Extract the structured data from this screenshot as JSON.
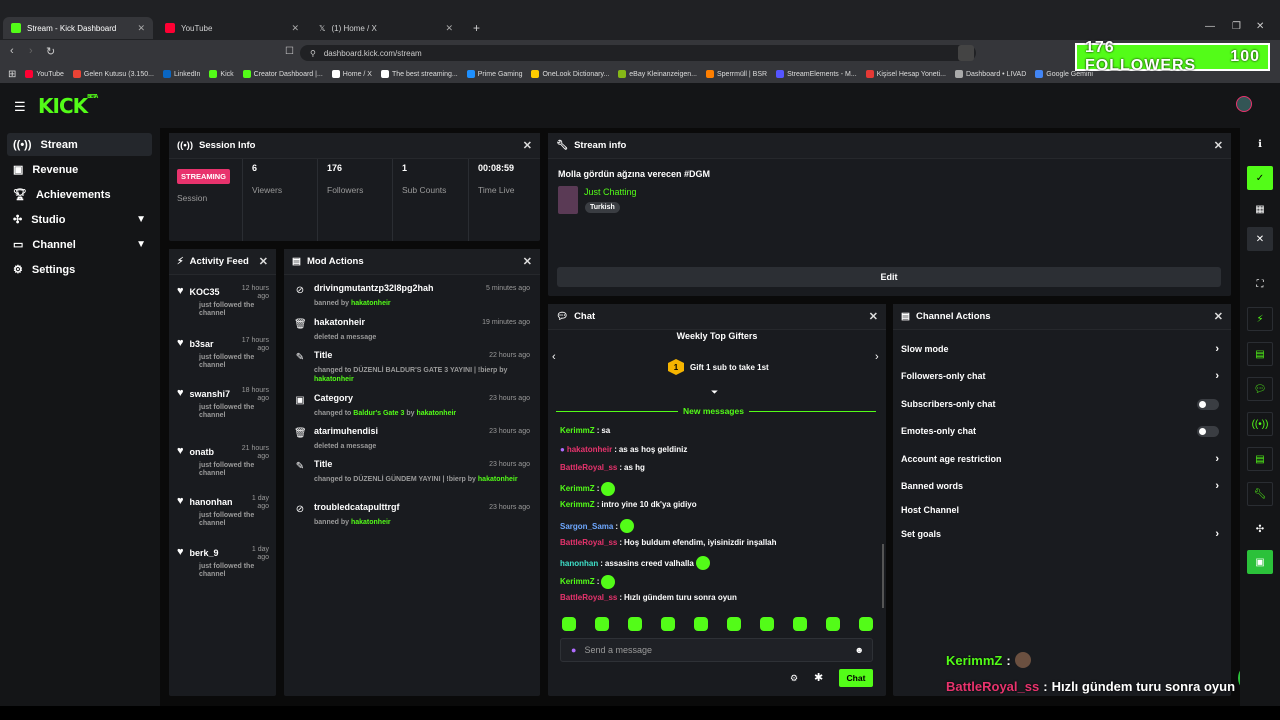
{
  "browser": {
    "tabs": [
      {
        "title": "Stream - Kick Dashboard",
        "color": "#53fc18"
      },
      {
        "title": "YouTube",
        "color": "#ff0033"
      },
      {
        "title": "(1) Home / X",
        "color": "#ffffff"
      }
    ],
    "url": "dashboard.kick.com/stream",
    "bookmarks": [
      {
        "label": "YouTube",
        "color": "#ff0033"
      },
      {
        "label": "Gelen Kutusu (3.150...",
        "color": "#ea4335"
      },
      {
        "label": "LinkedIn",
        "color": "#0a66c2"
      },
      {
        "label": "Kick",
        "color": "#53fc18"
      },
      {
        "label": "Creator Dashboard |...",
        "color": "#53fc18"
      },
      {
        "label": "Home / X",
        "color": "#ffffff"
      },
      {
        "label": "The best streaming...",
        "color": "#ffffff"
      },
      {
        "label": "Prime Gaming",
        "color": "#1e90ff"
      },
      {
        "label": "OneLook Dictionary...",
        "color": "#ffcc00"
      },
      {
        "label": "eBay Kleinanzeigen...",
        "color": "#86b817"
      },
      {
        "label": "Sperrmüll | BSR",
        "color": "#ff7f00"
      },
      {
        "label": "StreamElements - M...",
        "color": "#5555ff"
      },
      {
        "label": "Kişisel Hesap Yoneti...",
        "color": "#e53935"
      },
      {
        "label": "Dashboard • LIVAD",
        "color": "#aaaaaa"
      },
      {
        "label": "Google Gemini",
        "color": "#4285f4"
      }
    ]
  },
  "overlay": {
    "followers_label": "176 FOLLOWERS",
    "followers_goal": "100"
  },
  "app": {
    "logo": "KICK",
    "logo_badge": "BETA"
  },
  "sidebar": {
    "items": [
      {
        "label": "Stream",
        "icon": "broadcast-icon"
      },
      {
        "label": "Revenue",
        "icon": "wallet-icon"
      },
      {
        "label": "Achievements",
        "icon": "trophy-icon"
      },
      {
        "label": "Studio",
        "icon": "studio-icon"
      },
      {
        "label": "Channel",
        "icon": "channel-icon"
      },
      {
        "label": "Settings",
        "icon": "gear-icon"
      }
    ]
  },
  "session": {
    "title": "Session Info",
    "badge": "STREAMING",
    "badge_label": "Session",
    "stats": [
      {
        "value": "6",
        "label": "Viewers"
      },
      {
        "value": "176",
        "label": "Followers"
      },
      {
        "value": "1",
        "label": "Sub Counts"
      },
      {
        "value": "00:08:59",
        "label": "Time Live"
      }
    ]
  },
  "stream_info": {
    "title": "Stream info",
    "stream_title": "Molla gördün ağzına verecen #DGM",
    "category": "Just Chatting",
    "tag": "Turkish",
    "edit": "Edit"
  },
  "activity": {
    "title": "Activity Feed",
    "items": [
      {
        "name": "KOC35",
        "time": "12 hours ago",
        "desc": "just followed the channel"
      },
      {
        "name": "b3sar",
        "time": "17 hours ago",
        "desc": "just followed the channel"
      },
      {
        "name": "swanshi7",
        "time": "18 hours ago",
        "desc": "just followed the channel"
      },
      {
        "name": "onatb",
        "time": "21 hours ago",
        "desc": "just followed the channel"
      },
      {
        "name": "hanonhan",
        "time": "1 day ago",
        "desc": "just followed the channel"
      },
      {
        "name": "berk_9",
        "time": "1 day ago",
        "desc": "just followed the channel"
      }
    ]
  },
  "mod": {
    "title": "Mod Actions",
    "items": [
      {
        "title": "drivingmutantzp32l8pg2hah",
        "time": "5 minutes ago",
        "pre": "banned by",
        "by": "hakatonheir",
        "icon": "ban-icon"
      },
      {
        "title": "hakatonheir",
        "time": "19 minutes ago",
        "pre": "deleted a message",
        "by": "",
        "icon": "trash-icon"
      },
      {
        "title": "Title",
        "time": "22 hours ago",
        "pre": "changed to DÜZENLİ BALDUR'S GATE 3 YAYINI | !bierp by",
        "by": "hakatonheir",
        "icon": "edit-user-icon"
      },
      {
        "title": "Category",
        "time": "23 hours ago",
        "pre": "changed to",
        "mid": "Baldur's Gate 3",
        "post": "by",
        "by": "hakatonheir",
        "icon": "category-icon"
      },
      {
        "title": "atarimuhendisi",
        "time": "23 hours ago",
        "pre": "deleted a message",
        "by": "",
        "icon": "trash-icon"
      },
      {
        "title": "Title",
        "time": "23 hours ago",
        "pre": "changed to DÜZENLİ GÜNDEM YAYINI | !bierp by",
        "by": "hakatonheir",
        "icon": "edit-user-icon"
      },
      {
        "title": "troubledcatapulttrgf",
        "time": "23 hours ago",
        "pre": "banned by",
        "by": "hakatonheir",
        "icon": "ban-icon"
      }
    ]
  },
  "chat": {
    "title": "Chat",
    "gifters_title": "Weekly Top Gifters",
    "gifters_rank": "1",
    "gifters_text": "Gift 1 sub to take 1st",
    "new_messages": "New messages",
    "messages": [
      {
        "user": "KerimmZ",
        "color": "#53fc18",
        "text": "sa",
        "emote": false
      },
      {
        "user": "hakatonheir",
        "color": "#e8336d",
        "text": "as as hoş geldiniz",
        "emote": false
      },
      {
        "user": "BattleRoyal_ss",
        "color": "#e8336d",
        "text": "as hg",
        "emote": false
      },
      {
        "user": "KerimmZ",
        "color": "#53fc18",
        "text": "",
        "emote": true
      },
      {
        "user": "KerimmZ",
        "color": "#53fc18",
        "text": "intro yine 10 dk'ya gidiyo",
        "emote": false
      },
      {
        "user": "Sargon_Sama",
        "color": "#6ea8ff",
        "text": "",
        "emote": true
      },
      {
        "user": "BattleRoyal_ss",
        "color": "#e8336d",
        "text": "Hoş buldum efendim, iyisinizdir inşallah",
        "emote": false
      },
      {
        "user": "hanonhan",
        "color": "#3ee0c9",
        "text": "assasins creed valhalla",
        "emote": true
      },
      {
        "user": "KerimmZ",
        "color": "#53fc18",
        "text": "",
        "emote": true
      },
      {
        "user": "BattleRoyal_ss",
        "color": "#e8336d",
        "text": "Hızlı gündem turu sonra oyun",
        "emote": false
      }
    ],
    "placeholder": "Send a message",
    "send": "Chat"
  },
  "channel_actions": {
    "title": "Channel Actions",
    "items": [
      {
        "label": "Slow mode",
        "type": "arrow"
      },
      {
        "label": "Followers-only chat",
        "type": "arrow"
      },
      {
        "label": "Subscribers-only chat",
        "type": "toggle"
      },
      {
        "label": "Emotes-only chat",
        "type": "toggle"
      },
      {
        "label": "Account age restriction",
        "type": "arrow"
      },
      {
        "label": "Banned words",
        "type": "arrow"
      },
      {
        "label": "Host Channel",
        "type": "none"
      },
      {
        "label": "Set goals",
        "type": "arrow"
      }
    ]
  },
  "overlay_chat": [
    {
      "user": "KerimmZ",
      "color": "#53fc18",
      "text": ""
    },
    {
      "user": "BattleRoyal_ss",
      "color": "#e8336d",
      "text": "Hızlı gündem turu sonra oyun"
    }
  ]
}
